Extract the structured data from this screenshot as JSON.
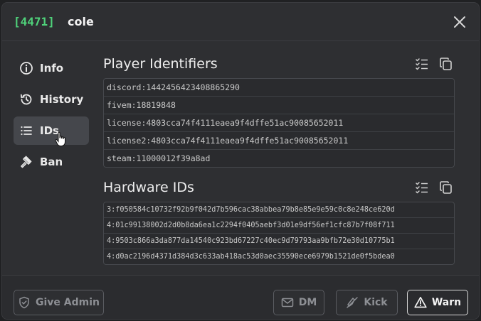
{
  "header": {
    "player_id": "[4471]",
    "player_name": "cole"
  },
  "sidebar": {
    "items": [
      {
        "label": "Info",
        "icon": "info-icon"
      },
      {
        "label": "History",
        "icon": "history-icon"
      },
      {
        "label": "IDs",
        "icon": "list-icon",
        "active": true
      },
      {
        "label": "Ban",
        "icon": "gavel-icon"
      }
    ]
  },
  "player_identifiers": {
    "title": "Player Identifiers",
    "rows": [
      "discord:1442456423408865290",
      "fivem:18819848",
      "license:4803cca74f4111eaea9f4dffe51ac90085652011",
      "license2:4803cca74f4111eaea9f4dffe51ac90085652011",
      "steam:11000012f39a8ad"
    ]
  },
  "hardware_ids": {
    "title": "Hardware IDs",
    "rows": [
      "3:f050584c10732f92b9f042d7b596cac38abbea79b8e85e9e59c0c8e248ce620d",
      "4:01c99138002d2d0b8da6ea1c2294f0405aebf3d01e9df56ef1cfc87b7f08f711",
      "4:9503c866a3da877da14540c923bd67227c40ec9d79793aa9bfb72e30d10775b1",
      "4:d0ac2196d4371d384d3c633ab418ac53d0aec35590ece6979b1521de0f5bdea0"
    ]
  },
  "footer": {
    "give_admin": "Give Admin",
    "dm": "DM",
    "kick": "Kick",
    "warn": "Warn"
  },
  "colors": {
    "accent_green": "#4fd17a",
    "modal_bg": "#2e2f32",
    "active_nav": "#45474c"
  }
}
